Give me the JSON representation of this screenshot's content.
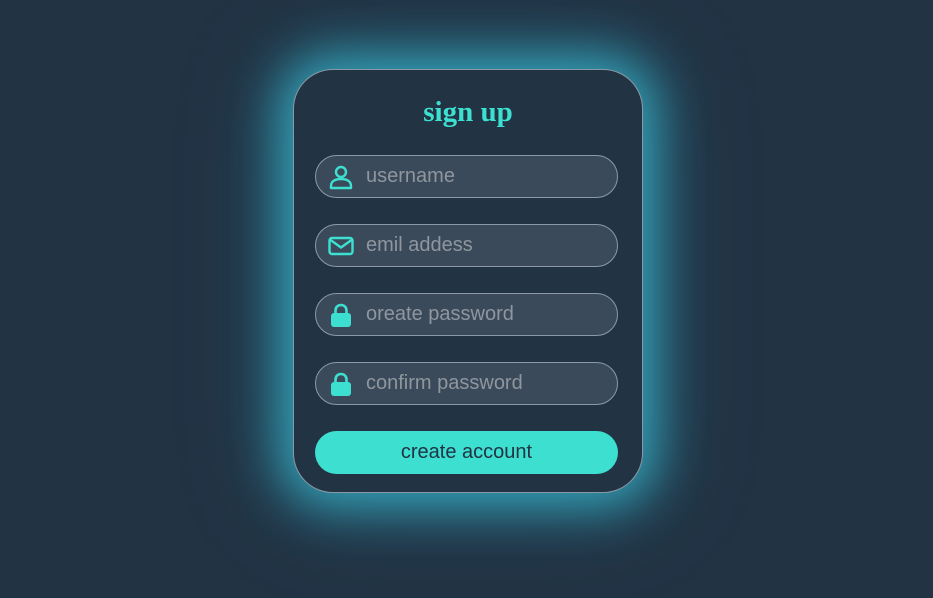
{
  "form": {
    "title": "sign up",
    "fields": [
      {
        "icon": "user-icon",
        "placeholder": "username",
        "value": ""
      },
      {
        "icon": "envelope-icon",
        "placeholder": "emil addess",
        "value": ""
      },
      {
        "icon": "lock-icon",
        "placeholder": "oreate password",
        "value": ""
      },
      {
        "icon": "lock-icon",
        "placeholder": "confirm password",
        "value": ""
      }
    ],
    "submit_label": "create account"
  },
  "colors": {
    "background": "#223344",
    "accent": "#3de0d0",
    "field_background": "#3b4a5a",
    "glow": "#38bed6"
  }
}
